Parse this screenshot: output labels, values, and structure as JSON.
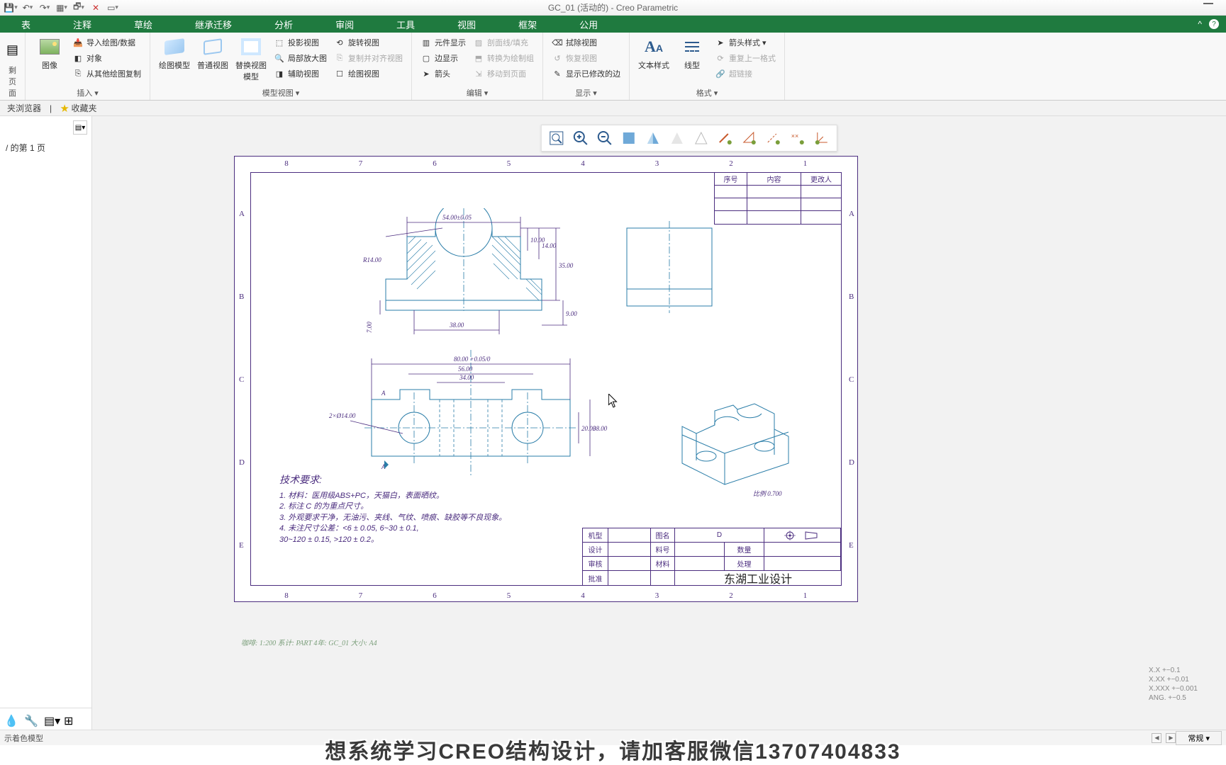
{
  "title": "GC_01 (活动的) - Creo Parametric",
  "tabs": [
    "表",
    "注释",
    "草绘",
    "继承迁移",
    "分析",
    "审阅",
    "工具",
    "视图",
    "框架",
    "公用"
  ],
  "ribbon": {
    "page_group": {
      "label": "剩页面"
    },
    "insert": {
      "label": "插入 ▾",
      "image": "图像",
      "items": [
        "导入绘图/数据",
        "对象",
        "从其他绘图复制"
      ]
    },
    "model_view": {
      "label": "模型视图 ▾",
      "big": [
        "绘图模型",
        "普通视图",
        "替换视图\n模型"
      ],
      "small_col1": [
        "投影视图",
        "局部放大图",
        "辅助视图"
      ],
      "small_col2": [
        "旋转视图",
        "复制并对齐视图",
        "绘图视图"
      ]
    },
    "edit": {
      "label": "编辑 ▾",
      "col1": [
        "元件显示",
        "边显示",
        "箭头"
      ],
      "col2": [
        "剖面线/填充",
        "转换为绘制组",
        "移动到页面"
      ]
    },
    "display": {
      "label": "显示 ▾",
      "col1": [
        "拭除视图",
        "恢复视图",
        "显示已修改的边"
      ]
    },
    "format": {
      "label": "格式 ▾",
      "big": [
        "文本样式",
        "线型"
      ],
      "small": [
        "箭头样式 ▾",
        "重复上一格式",
        "超链接"
      ]
    }
  },
  "sec_tabs": {
    "browser": "夹浏览器",
    "fav": "收藏夹"
  },
  "tree": {
    "page_label": "/ 的第 1 页"
  },
  "drawing": {
    "zones_top": [
      "8",
      "7",
      "6",
      "5",
      "4",
      "3",
      "2",
      "1"
    ],
    "zones_side": [
      "A",
      "B",
      "C",
      "D",
      "E"
    ],
    "rev_headers": [
      "序号",
      "内容",
      "更改人"
    ],
    "dims": {
      "d54": "54.00±0.05",
      "r14": "R14.00",
      "d10": "10.00",
      "d14": "14.00",
      "d35": "35.00",
      "d38": "38.00",
      "d7": "7.00",
      "d9": "9.00",
      "d80": "80.00 +0.05/0",
      "d56": "56.00",
      "d34": "34.00",
      "d2x14": "2×Ø14.00",
      "d20": "20.00",
      "d38b": "38.00",
      "scale_iso": "比例 0.700"
    },
    "notes_title": "技术要求:",
    "notes": [
      "1. 材料：医用级ABS+PC，天猫白，表面晒纹。",
      "2. 标注 C 的为重点尺寸。",
      "3. 外观要求干净，无油污、夹线、气纹、喷痕、缺胶等不良现象。",
      "4. 未注尺寸公差：<6 ± 0.05, 6~30 ± 0.1,",
      "    30~120 ± 0.15, >120 ± 0.2。"
    ],
    "titleblock": {
      "r1": [
        "机型",
        "",
        "图名",
        "D"
      ],
      "r2": [
        "设计",
        "",
        "料号",
        "",
        "数量",
        ""
      ],
      "r3": [
        "审核",
        "",
        "材料",
        "",
        "处理",
        ""
      ],
      "r4": [
        "批准",
        ""
      ],
      "company": "东湖工业设计"
    },
    "meta_line": "咖啡: 1:200   系计: PART   4年: GC_01   大小: A4"
  },
  "coord_info": [
    "X.X    +−0.1",
    "X.XX   +−0.01",
    "X.XXX +−0.001",
    "ANG.  +−0.5"
  ],
  "statusbar": {
    "left": "示着色模型",
    "mode": "常规"
  },
  "subtitle": "想系统学习CREO结构设计，请加客服微信13707404833"
}
